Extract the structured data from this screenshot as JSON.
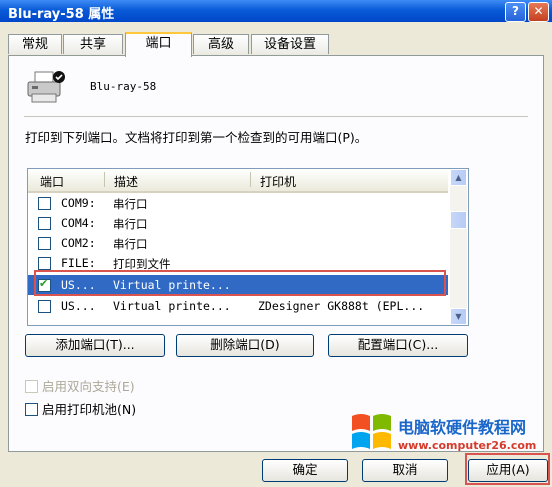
{
  "window": {
    "title": "Blu-ray-58 属性",
    "help_label": "?",
    "close_label": "✕"
  },
  "tabs": [
    {
      "label": "常规",
      "active": false
    },
    {
      "label": "共享",
      "active": false
    },
    {
      "label": "端口",
      "active": true
    },
    {
      "label": "高级",
      "active": false
    },
    {
      "label": "设备设置",
      "active": false
    }
  ],
  "printer": {
    "name": "Blu-ray-58"
  },
  "description": "打印到下列端口。文档将打印到第一个检查到的可用端口(P)。",
  "port_list": {
    "columns": [
      "端口",
      "描述",
      "打印机"
    ],
    "rows": [
      {
        "checked": false,
        "port": "COM9:",
        "desc": "串行口",
        "printer": ""
      },
      {
        "checked": false,
        "port": "COM4:",
        "desc": "串行口",
        "printer": ""
      },
      {
        "checked": false,
        "port": "COM2:",
        "desc": "串行口",
        "printer": ""
      },
      {
        "checked": false,
        "port": "FILE:",
        "desc": "打印到文件",
        "printer": ""
      },
      {
        "checked": true,
        "port": "US...",
        "desc": "Virtual printe...",
        "printer": "",
        "selected": true
      },
      {
        "checked": false,
        "port": "US...",
        "desc": "Virtual printe...",
        "printer": "ZDesigner GK888t (EPL..."
      }
    ]
  },
  "buttons": {
    "add_port": "添加端口(T)...",
    "delete_port": "删除端口(D)",
    "config_port": "配置端口(C)..."
  },
  "options": {
    "bidirectional": {
      "label": "启用双向支持(E)",
      "checked": false,
      "disabled": true
    },
    "pooling": {
      "label": "启用打印机池(N)",
      "checked": false,
      "disabled": false
    }
  },
  "footer": {
    "ok": "确定",
    "cancel": "取消",
    "apply": "应用(A)"
  },
  "watermark": {
    "text": "电脑软硬件教程网",
    "url": "www.computer26.com"
  },
  "colors": {
    "accent": "#316AC5",
    "highlight": "#D9534F"
  }
}
